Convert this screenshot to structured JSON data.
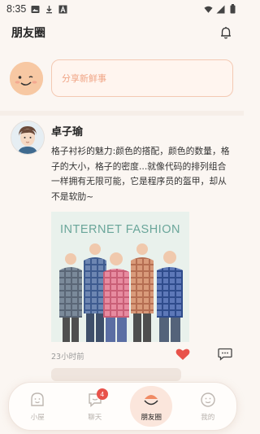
{
  "status_bar": {
    "time": "8:35"
  },
  "header": {
    "title": "朋友圈"
  },
  "compose": {
    "placeholder": "分享新鲜事"
  },
  "post": {
    "author": "卓子瑜",
    "text": "格子衬衫的魅力:颜色的搭配，颜色的数量，格子的大小，格子的密度...就像代码的排列组合一样拥有无限可能，它是程序员的盔甲，却从不是软肋~",
    "image_caption": "INTERNET  FASHION",
    "time": "23小时前",
    "liked": true
  },
  "bottom_nav": {
    "items": [
      {
        "label": "小屋",
        "icon": "smiley-icon"
      },
      {
        "label": "聊天",
        "icon": "chat-icon",
        "badge": "4"
      },
      {
        "label": "朋友圈",
        "icon": "moments-icon",
        "active": true
      },
      {
        "label": "我的",
        "icon": "profile-icon"
      }
    ]
  },
  "colors": {
    "accent": "#f0a586",
    "like": "#e8524a",
    "background": "#fbf6f2"
  }
}
